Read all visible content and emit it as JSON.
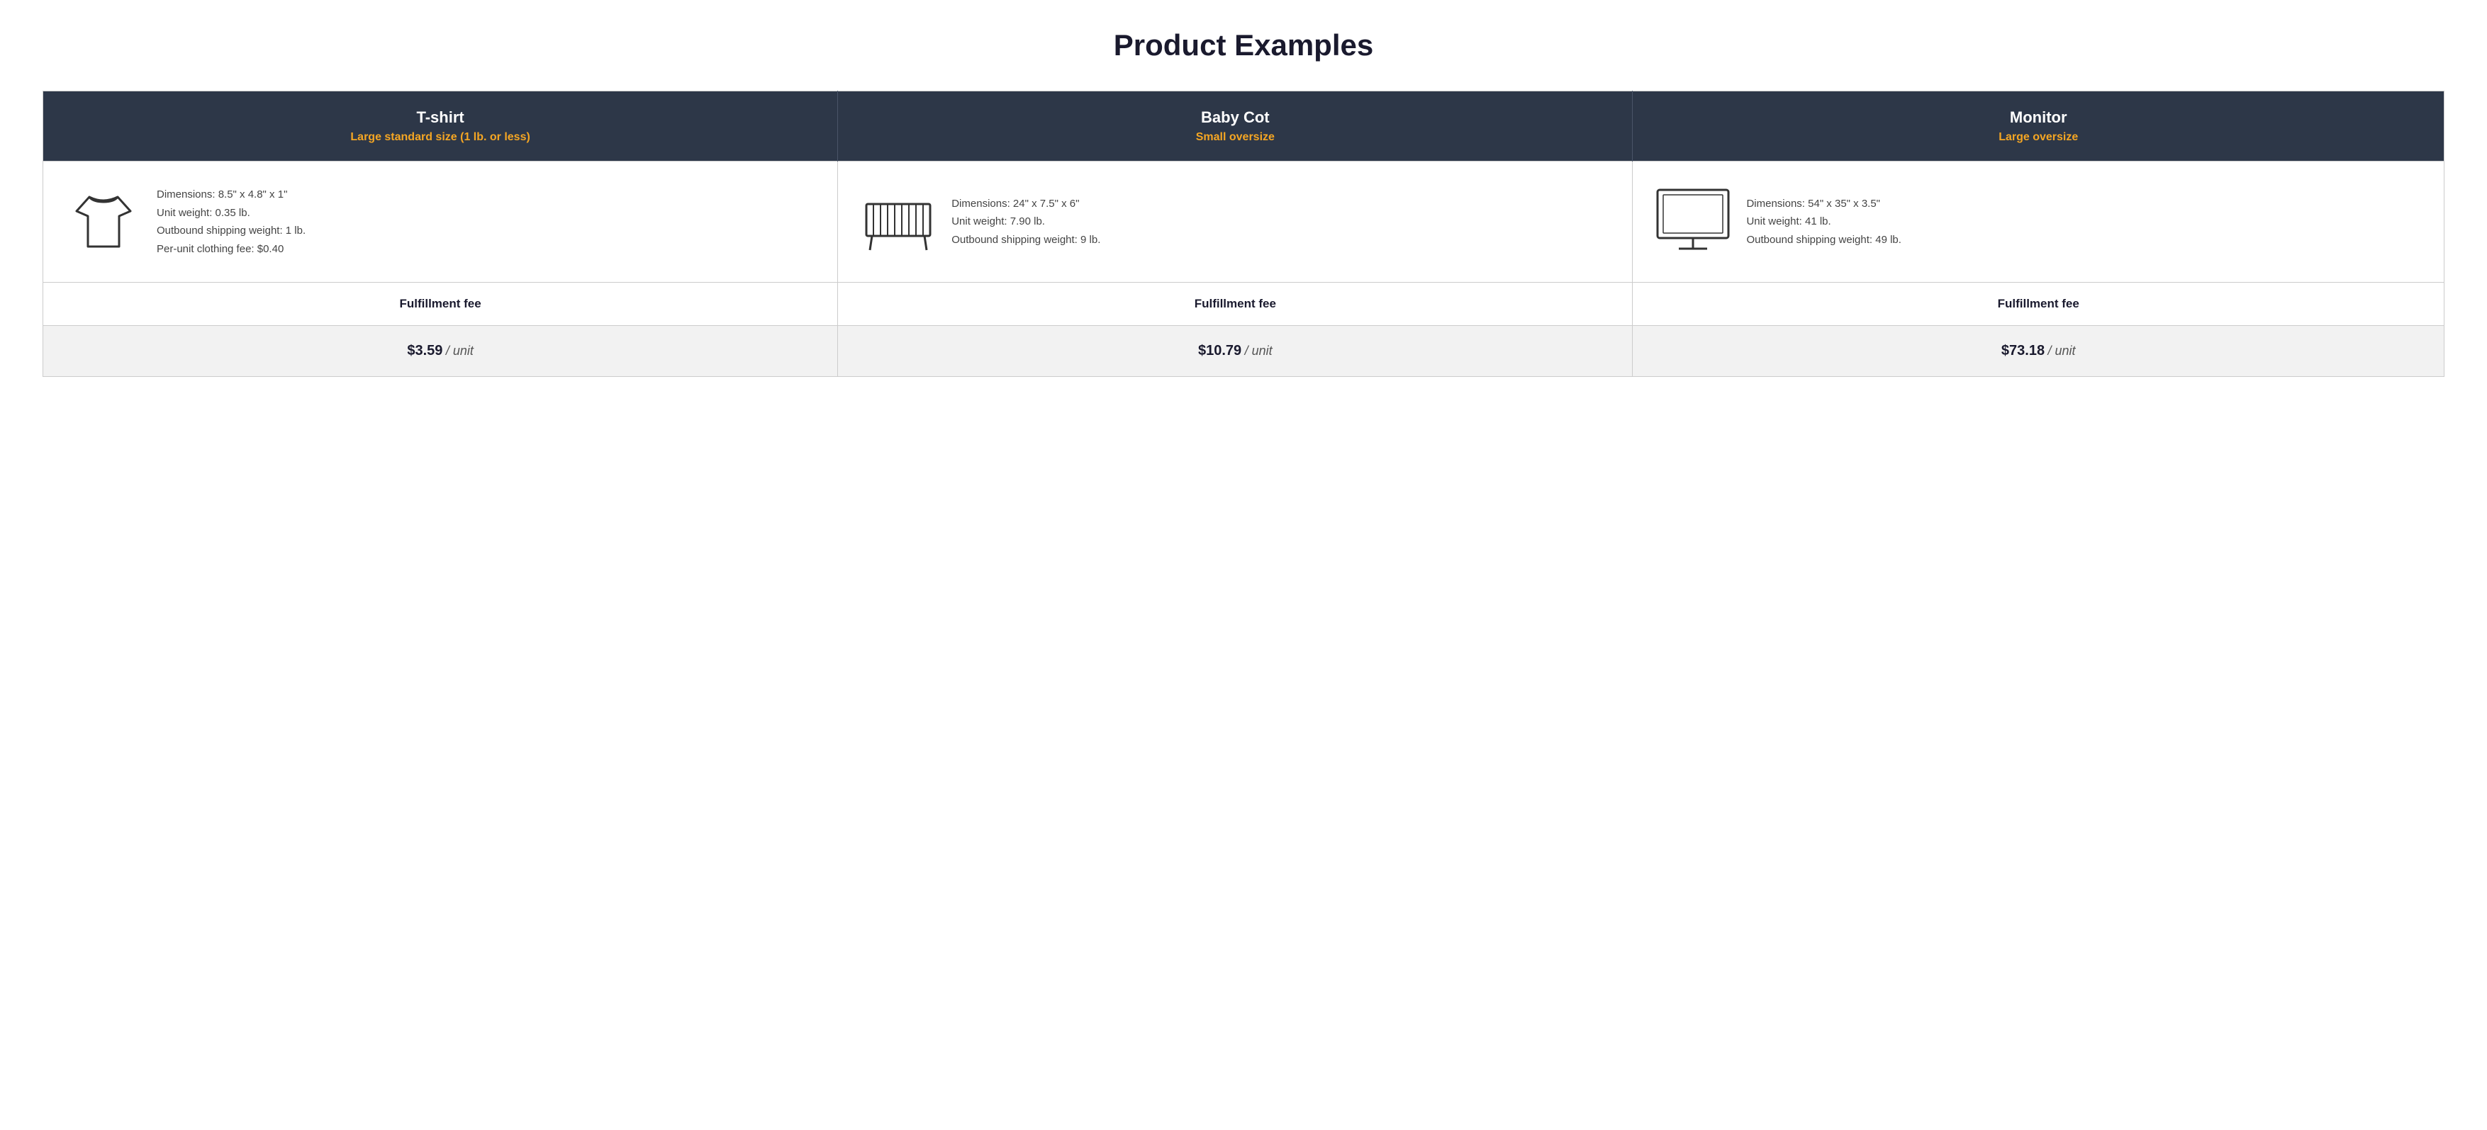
{
  "page": {
    "title": "Product Examples"
  },
  "products": [
    {
      "id": "tshirt",
      "name": "T-shirt",
      "size_label": "Large standard size (1 lb. or less)",
      "dimensions": "Dimensions: 8.5\" x 4.8\" x 1\"",
      "unit_weight": "Unit weight: 0.35 lb.",
      "outbound_weight": "Outbound shipping weight: 1 lb.",
      "extra": "Per-unit clothing fee: $0.40",
      "fulfillment_label": "Fulfillment fee",
      "fee": "$3.59",
      "fee_unit": "/ unit",
      "icon": "tshirt"
    },
    {
      "id": "babycot",
      "name": "Baby Cot",
      "size_label": "Small oversize",
      "dimensions": "Dimensions: 24\" x 7.5\" x 6\"",
      "unit_weight": "Unit weight: 7.90 lb.",
      "outbound_weight": "Outbound shipping weight: 9 lb.",
      "extra": "",
      "fulfillment_label": "Fulfillment fee",
      "fee": "$10.79",
      "fee_unit": "/ unit",
      "icon": "cot"
    },
    {
      "id": "monitor",
      "name": "Monitor",
      "size_label": "Large oversize",
      "dimensions": "Dimensions: 54\" x 35\" x 3.5\"",
      "unit_weight": "Unit weight: 41 lb.",
      "outbound_weight": "Outbound shipping weight: 49 lb.",
      "extra": "",
      "fulfillment_label": "Fulfillment fee",
      "fee": "$73.18",
      "fee_unit": "/ unit",
      "icon": "monitor"
    }
  ]
}
